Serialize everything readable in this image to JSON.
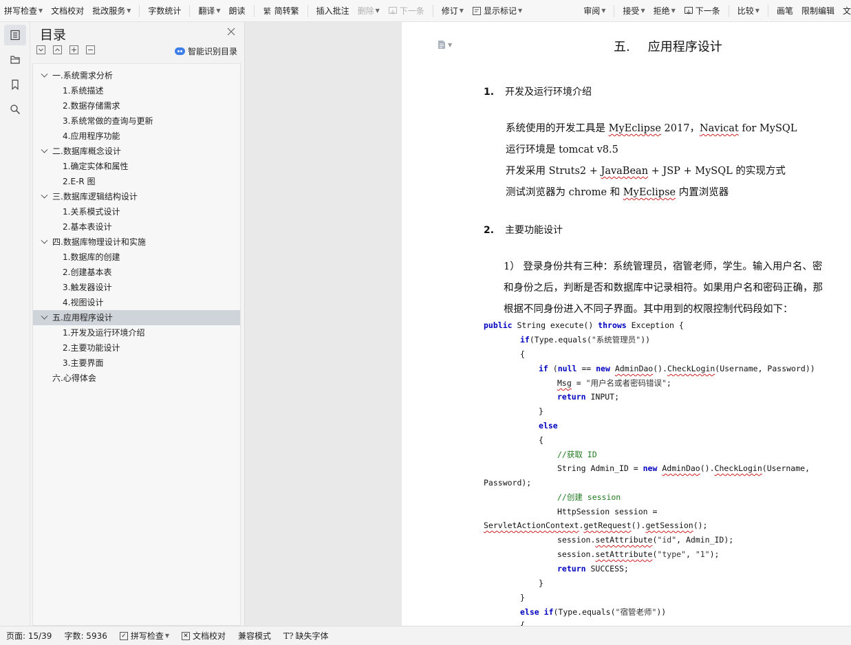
{
  "toolbar": {
    "items": [
      {
        "label": "拼写检查",
        "caret": true
      },
      {
        "label": "文档校对",
        "caret": false
      },
      {
        "label": "批改服务",
        "caret": true
      },
      {
        "label": "字数统计",
        "caret": false
      },
      {
        "label": "翻译",
        "caret": true
      },
      {
        "label": "朗读",
        "caret": false
      },
      {
        "label": "简转繁",
        "caret": false
      },
      {
        "label": "插入批注",
        "caret": false
      },
      {
        "label": "删除",
        "caret": true
      },
      {
        "label": "下一条",
        "caret": false
      },
      {
        "label": "修订",
        "caret": true
      },
      {
        "label": "显示标记",
        "caret": true
      }
    ],
    "right_items": [
      {
        "label": "审阅",
        "caret": true
      },
      {
        "label": "接受",
        "caret": true
      },
      {
        "label": "拒绝",
        "caret": true
      },
      {
        "label": "下一条",
        "caret": false
      },
      {
        "label": "比较",
        "caret": true
      },
      {
        "label": "画笔",
        "caret": false
      },
      {
        "label": "限制编辑",
        "caret": false
      },
      {
        "label": "文",
        "caret": false
      }
    ]
  },
  "toc": {
    "title": "目录",
    "smart_label": "智能识别目录",
    "items": [
      {
        "label": "一.系统需求分析",
        "level": 1,
        "expanded": true
      },
      {
        "label": "1.系统描述",
        "level": 2
      },
      {
        "label": "2.数据存储需求",
        "level": 2
      },
      {
        "label": "3.系统常做的查询与更新",
        "level": 2
      },
      {
        "label": "4.应用程序功能",
        "level": 2
      },
      {
        "label": "二.数据库概念设计",
        "level": 1,
        "expanded": true
      },
      {
        "label": "1.确定实体和属性",
        "level": 2
      },
      {
        "label": "2.E-R 图",
        "level": 2
      },
      {
        "label": "三.数据库逻辑结构设计",
        "level": 1,
        "expanded": true
      },
      {
        "label": "1.关系模式设计",
        "level": 2
      },
      {
        "label": "2.基本表设计",
        "level": 2
      },
      {
        "label": "四.数据库物理设计和实施",
        "level": 1,
        "expanded": true
      },
      {
        "label": "1.数据库的创建",
        "level": 2
      },
      {
        "label": "2.创建基本表",
        "level": 2
      },
      {
        "label": "3.触发器设计",
        "level": 2
      },
      {
        "label": "4.视图设计",
        "level": 2
      },
      {
        "label": "五.应用程序设计",
        "level": 1,
        "expanded": true,
        "selected": true
      },
      {
        "label": "1.开发及运行环境介绍",
        "level": 2
      },
      {
        "label": "2.主要功能设计",
        "level": 2
      },
      {
        "label": "3.主要界面",
        "level": 2
      },
      {
        "label": "六.心得体会",
        "level": 1,
        "expanded": false
      }
    ]
  },
  "document": {
    "heading_num": "五.",
    "heading_text": "应用程序设计",
    "sec1_num": "1.",
    "sec1_text": "开发及运行环境介绍",
    "env_lines": {
      "l1a": "系统使用的开发工具是 ",
      "l1b": "MyEclipse",
      "l1c": " 2017，",
      "l1d": "Navicat",
      "l1e": " for MySQL",
      "l2": "运行环境是 tomcat v8.5",
      "l3a": "开发采用 Struts2 + ",
      "l3b": "JavaBean",
      "l3c": " + JSP + MySQL 的实现方式",
      "l4a": "测试浏览器为 chrome 和 ",
      "l4b": "MyEclipse",
      "l4c": " 内置浏览器"
    },
    "sec2_num": "2.",
    "sec2_text": "主要功能设计",
    "func_lines": [
      "1）  登录身份共有三种：系统管理员，宿管老师，学生。输入用户名、密",
      "和身份之后，判断是否和数据库中记录相符。如果用户名和密码正确，那",
      "根据不同身份进入不同子界面。其中用到的权限控制代码段如下："
    ],
    "code": {
      "c1_kw1": "public",
      "c1_t1": " String execute() ",
      "c1_kw2": "throws",
      "c1_t2": " Exception {",
      "c2_kw": "if",
      "c2_t1": "(Type.equals(",
      "c2_s": "\"系统管理员\"",
      "c2_t2": "))",
      "c3": "{",
      "c4_kw1": "if",
      "c4_t1": " (",
      "c4_kw2": "null",
      "c4_t2": " == ",
      "c4_kw3": "new",
      "c4_t3a": " ",
      "c4_t3b": "AdminDao",
      "c4_t3c": "().",
      "c4_t3d": "CheckLogin",
      "c4_t3e": "(Username, Password))",
      "c5_t1": "Msg",
      "c5_t2": " = ",
      "c5_s": "\"用户名或者密码错误\"",
      "c5_t3": ";",
      "c6_kw": "return",
      "c6_t": " INPUT;",
      "c7": "}",
      "c8_kw": "else",
      "c9": "{",
      "c10_cm": "//获取 ID",
      "c11_t1": "String Admin_ID = ",
      "c11_kw": "new",
      "c11_t2a": " ",
      "c11_t2b": "AdminDao",
      "c11_t2c": "().",
      "c11_t2d": "CheckLogin",
      "c11_t2e": "(Username,",
      "c12": "Password);",
      "c13_cm": "//创建 session",
      "c14_t": "HttpSession session =",
      "c15_a": "ServletActionContext",
      "c15_b": ".",
      "c15_c": "getRequest",
      "c15_d": "().",
      "c15_e": "getSession",
      "c15_f": "();",
      "c16_t1": "session.",
      "c16_t2": "setAttribute",
      "c16_t3": "(",
      "c16_s1": "\"id\"",
      "c16_t4": ", Admin_ID);",
      "c17_t1": "session.",
      "c17_t2": "setAttribute",
      "c17_t3": "(",
      "c17_s1": "\"type\"",
      "c17_t4": ", ",
      "c17_s2": "\"1\"",
      "c17_t5": ");",
      "c18_kw": "return",
      "c18_t": " SUCCESS;",
      "c19": "}",
      "c20": "}",
      "c21_kw1": "else",
      "c21_t1": " ",
      "c21_kw2": "if",
      "c21_t2": "(Type.equals(",
      "c21_s": "\"宿管老师\"",
      "c21_t3": "))",
      "c22": "{"
    }
  },
  "status": {
    "page": "页面: 15/39",
    "words": "字数: 5936",
    "spell": "拼写检查",
    "proof": "文档校对",
    "compat": "兼容模式",
    "fonts": "缺失字体"
  }
}
